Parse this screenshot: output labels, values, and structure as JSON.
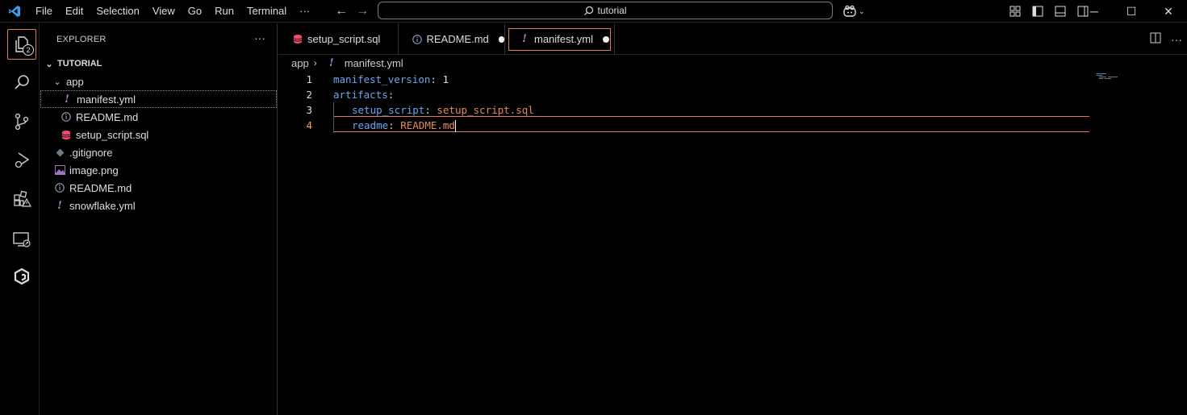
{
  "menu": [
    "File",
    "Edit",
    "Selection",
    "View",
    "Go",
    "Run",
    "Terminal",
    "···"
  ],
  "command_center": {
    "label": "tutorial"
  },
  "window": {
    "minimize": "─",
    "maximize": "☐",
    "close": "✕"
  },
  "activity": {
    "explorer_badge": "2"
  },
  "sidebar": {
    "title": "EXPLORER",
    "more": "···",
    "root": "TUTORIAL",
    "items": [
      {
        "label": "app",
        "type": "folder"
      },
      {
        "label": "manifest.yml",
        "type": "yml"
      },
      {
        "label": "README.md",
        "type": "info"
      },
      {
        "label": "setup_script.sql",
        "type": "sql"
      },
      {
        "label": ".gitignore",
        "type": "git"
      },
      {
        "label": "image.png",
        "type": "image"
      },
      {
        "label": "README.md",
        "type": "info"
      },
      {
        "label": "snowflake.yml",
        "type": "yml"
      }
    ]
  },
  "tabs": [
    {
      "label": "setup_script.sql",
      "icon": "database-icon",
      "dirty": false
    },
    {
      "label": "README.md",
      "icon": "info-icon",
      "dirty": true
    },
    {
      "label": "manifest.yml",
      "icon": "yaml-icon",
      "dirty": true,
      "active": true
    }
  ],
  "breadcrumb": {
    "folder": "app",
    "file": "manifest.yml"
  },
  "editor": {
    "lines": [
      {
        "n": "1",
        "key": "manifest_version",
        "sep": ": ",
        "val": "1"
      },
      {
        "n": "2",
        "key": "artifacts",
        "sep": ":",
        "val": ""
      },
      {
        "n": "3",
        "key": "setup_script",
        "sep": ": ",
        "val": "setup_script.sql"
      },
      {
        "n": "4",
        "key": "readme",
        "sep": ": ",
        "val": "README.md"
      }
    ]
  },
  "colors": {
    "accent": "#e07b53",
    "key": "#6aa6f0",
    "value": "#e38b5b",
    "yaml": "#b180d7"
  }
}
